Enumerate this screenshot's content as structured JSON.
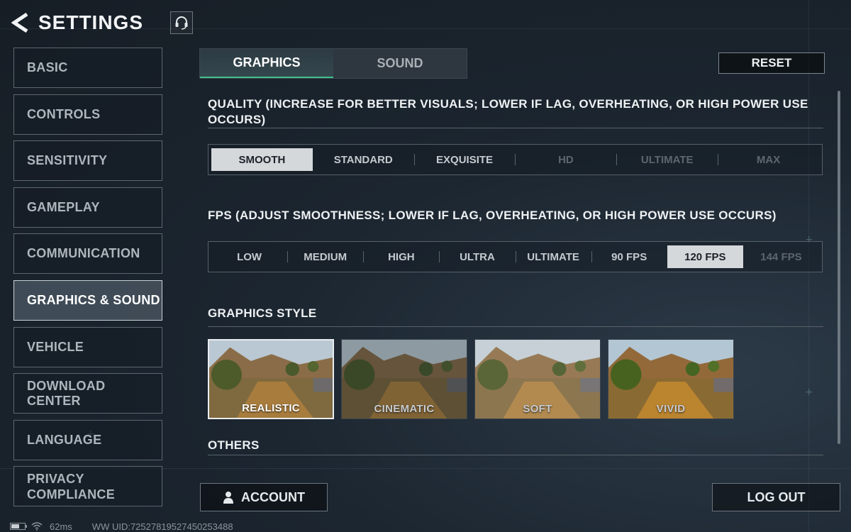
{
  "header": {
    "title": "SETTINGS"
  },
  "sidebar": {
    "items": [
      {
        "label": "BASIC"
      },
      {
        "label": "CONTROLS"
      },
      {
        "label": "SENSITIVITY"
      },
      {
        "label": "GAMEPLAY"
      },
      {
        "label": "COMMUNICATION"
      },
      {
        "label": "GRAPHICS & SOUND",
        "active": true
      },
      {
        "label": "VEHICLE"
      },
      {
        "label": "DOWNLOAD CENTER"
      },
      {
        "label": "LANGUAGE"
      },
      {
        "label_line1": "PRIVACY",
        "label_line2": "COMPLIANCE"
      }
    ]
  },
  "tabs": [
    {
      "label": "GRAPHICS",
      "active": true
    },
    {
      "label": "SOUND",
      "active": false
    }
  ],
  "reset_label": "RESET",
  "quality": {
    "title_line1": "QUALITY (INCREASE FOR BETTER VISUALS; LOWER IF LAG, OVERHEATING, OR HIGH POWER USE",
    "title_line2": "OCCURS)",
    "options": [
      "SMOOTH",
      "STANDARD",
      "EXQUISITE",
      "HD",
      "ULTIMATE",
      "MAX"
    ],
    "selected": "SMOOTH"
  },
  "fps": {
    "title": "FPS (ADJUST SMOOTHNESS; LOWER IF LAG, OVERHEATING, OR HIGH POWER USE OCCURS)",
    "options": [
      "LOW",
      "MEDIUM",
      "HIGH",
      "ULTRA",
      "ULTIMATE",
      "90 FPS",
      "120 FPS",
      "144 FPS"
    ],
    "selected": "120 FPS"
  },
  "graphics_style": {
    "title": "GRAPHICS STYLE",
    "options": [
      "REALISTIC",
      "CINEMATIC",
      "SOFT",
      "VIVID"
    ],
    "selected": "REALISTIC"
  },
  "others_title": "OTHERS",
  "account_label": "ACCOUNT",
  "logout_label": "LOG OUT",
  "status": {
    "ping": "62ms",
    "uid": "WW UID:72527819527450253488",
    "battery_level": 0.6
  },
  "icons": [
    "back-arrow-icon",
    "headset-icon",
    "user-icon",
    "battery-icon",
    "wifi-icon"
  ],
  "colors": {
    "accent_green": "#3fbf8a",
    "selected_bg": "#d5d8db"
  }
}
